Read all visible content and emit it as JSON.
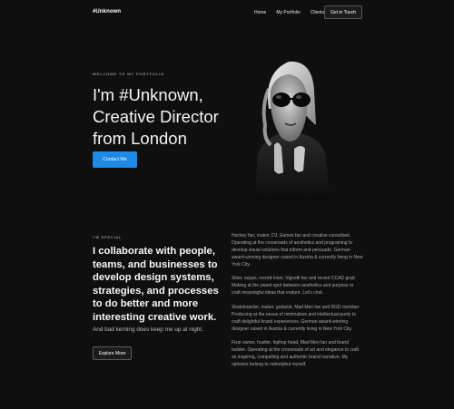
{
  "nav": {
    "logo": "#Unknown",
    "links": [
      "Home",
      "My Portfolio",
      "Clients"
    ],
    "cta_label": "Get in Touch"
  },
  "hero": {
    "eyebrow": "WELCOME TO MY PORTFOLIO",
    "title": "I'm #Unknown, Creative Director from London",
    "button_label": "Contact Me"
  },
  "about": {
    "eyebrow": "I'M SPECIAL",
    "heading": "I collaborate with people, teams, and businesses to develop design systems, strategies, and processes to do better and more interesting creative work.",
    "subtext": "And bad kerning does keep me up at night.",
    "button_label": "Explore More",
    "paragraphs": [
      "Hockey fan, maker, DJ, Eames fan and creative consultant. Operating at the crossroads of aesthetics and programing to develop visual solutions that inform and persuade. German award-winning designer raised in Austria & currently living in New York City.",
      "Skier, vegan, record lover, Vignelli fan and recent CCAD grad. Making at the sweet spot between aesthetics and purpose to craft meaningful ideas that endure. Let's chat.",
      "Skateboarder, maker, guitarist, Mad Men fan and RGD member. Producing at the nexus of minimalism and intellectual purity to craft delightful brand experiences. German award-winning designer raised in Austria & currently living in New York City.",
      "Fixie owner, hustler, hiphop head, Mad Men fan and brand builder. Operating at the crossroads of art and elegance to craft an inspiring, compelling and authentic brand narrative. My opinions belong to nobodybut myself."
    ]
  },
  "colors": {
    "background": "#0f0f10",
    "accent": "#1e8ae6",
    "text": "#ffffff",
    "muted": "#a9a9a9"
  }
}
